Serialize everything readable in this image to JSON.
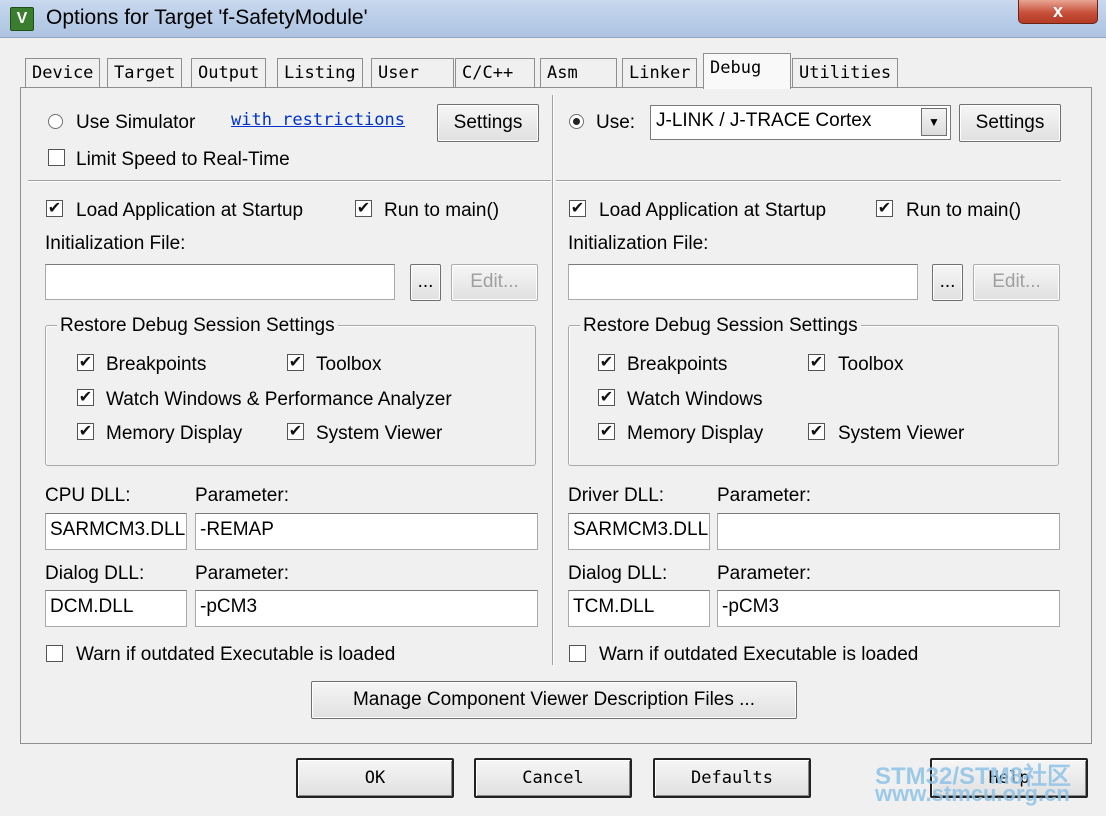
{
  "window": {
    "app_icon": "V",
    "title": "Options for Target 'f-SafetyModule'",
    "close": "x"
  },
  "tabs": [
    "Device",
    "Target",
    "Output",
    "Listing",
    "User",
    "C/C++",
    "Asm",
    "Linker",
    "Debug",
    "Utilities"
  ],
  "active_tab": "Debug",
  "left": {
    "use_simulator": "Use Simulator",
    "restrictions_link": "with restrictions",
    "settings": "Settings",
    "limit_speed": "Limit Speed to Real-Time",
    "load_app": "Load Application at Startup",
    "run_to_main": "Run to main()",
    "init_file_label": "Initialization File:",
    "init_file_value": "",
    "browse": "...",
    "edit": "Edit...",
    "restore_group": "Restore Debug Session Settings",
    "breakpoints": "Breakpoints",
    "toolbox": "Toolbox",
    "watch_windows": "Watch Windows & Performance Analyzer",
    "memory_display": "Memory Display",
    "system_viewer": "System Viewer",
    "dll_label": "CPU DLL:",
    "param_label": "Parameter:",
    "dll_value": "SARMCM3.DLL",
    "dll_param": "-REMAP",
    "dialog_dll_label": "Dialog DLL:",
    "dialog_param_label": "Parameter:",
    "dialog_dll_value": "DCM.DLL",
    "dialog_param": "-pCM3",
    "warn": "Warn if outdated Executable is loaded"
  },
  "right": {
    "use": "Use:",
    "driver_select": "J-LINK / J-TRACE Cortex",
    "settings": "Settings",
    "load_app": "Load Application at Startup",
    "run_to_main": "Run to main()",
    "init_file_label": "Initialization File:",
    "init_file_value": "",
    "browse": "...",
    "edit": "Edit...",
    "restore_group": "Restore Debug Session Settings",
    "breakpoints": "Breakpoints",
    "toolbox": "Toolbox",
    "watch_windows": "Watch Windows",
    "memory_display": "Memory Display",
    "system_viewer": "System Viewer",
    "dll_label": "Driver DLL:",
    "param_label": "Parameter:",
    "dll_value": "SARMCM3.DLL",
    "dll_param": "",
    "dialog_dll_label": "Dialog DLL:",
    "dialog_param_label": "Parameter:",
    "dialog_dll_value": "TCM.DLL",
    "dialog_param": "-pCM3",
    "warn": "Warn if outdated Executable is loaded"
  },
  "manage_button": "Manage Component Viewer Description Files ...",
  "footer": {
    "ok": "OK",
    "cancel": "Cancel",
    "defaults": "Defaults",
    "help": "Help"
  },
  "watermark": {
    "line1": "STM32/STM8社区",
    "line2": "www.stmcu.org.cn"
  },
  "checks": {
    "check_mark": "✔"
  }
}
